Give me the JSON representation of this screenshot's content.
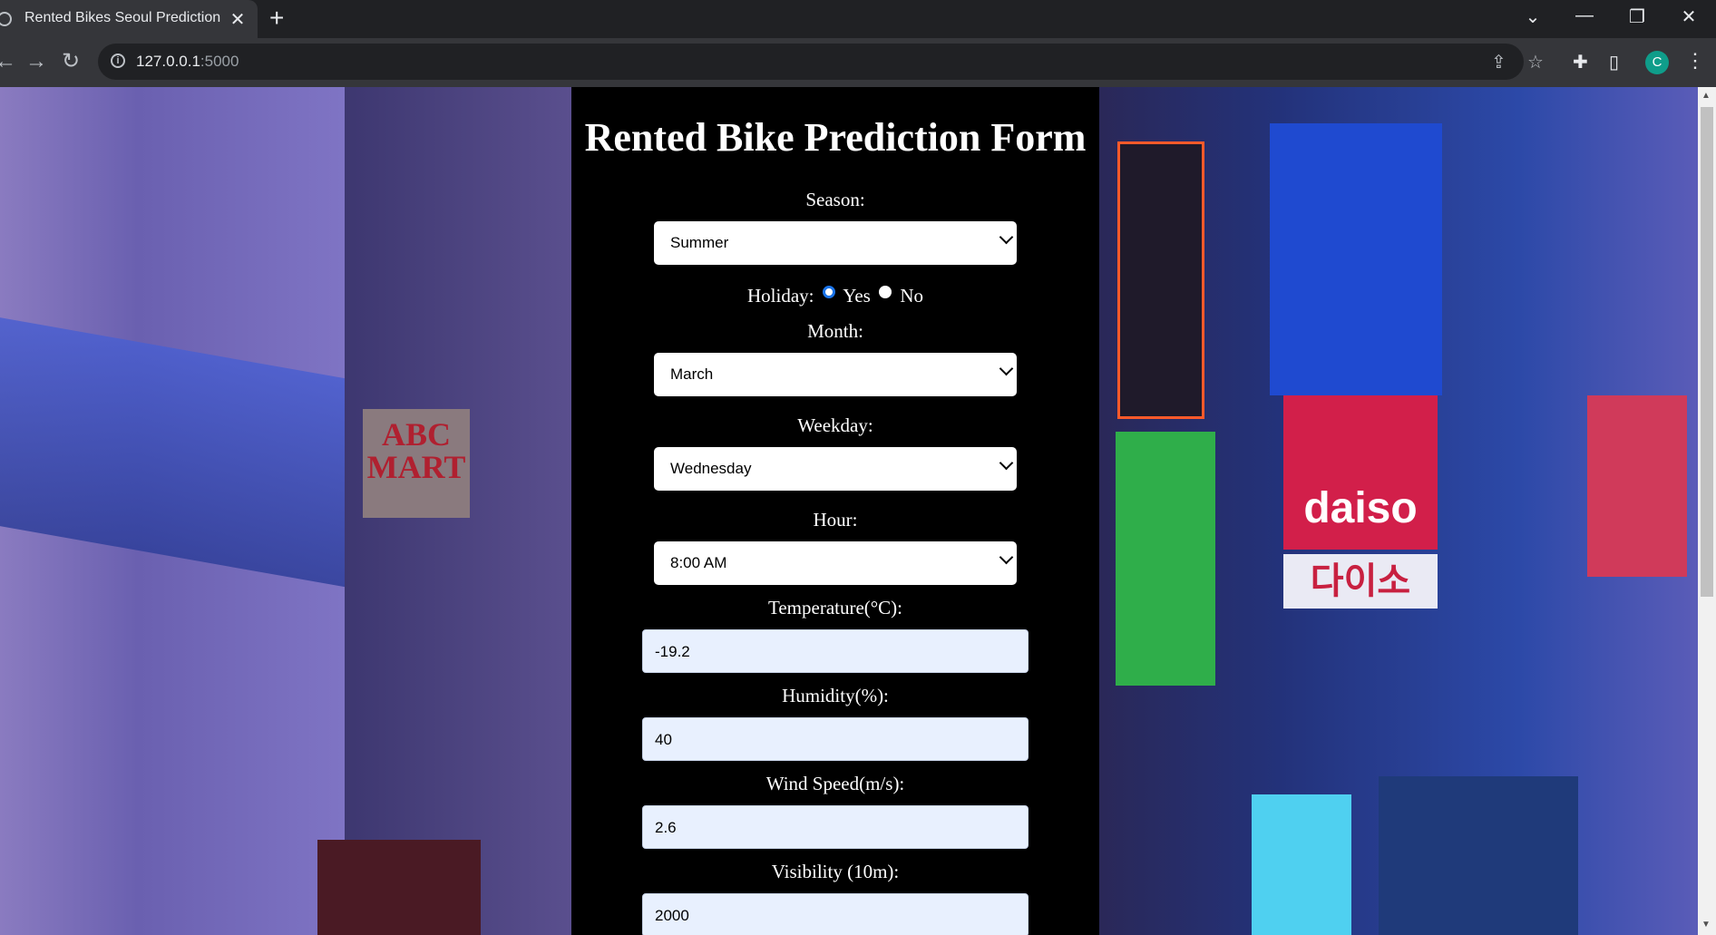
{
  "browser": {
    "tab_title": "Rented Bikes Seoul Prediction",
    "tab_close": "✕",
    "new_tab": "+",
    "url_host": "127.0.0.1",
    "url_port": ":5000",
    "avatar_letter": "C"
  },
  "form": {
    "title": "Rented Bike Prediction Form",
    "season": {
      "label": "Season:",
      "value": "Summer"
    },
    "holiday": {
      "label": "Holiday:",
      "options": [
        "Yes",
        "No"
      ],
      "selected": "Yes"
    },
    "month": {
      "label": "Month:",
      "value": "March"
    },
    "weekday": {
      "label": "Weekday:",
      "value": "Wednesday"
    },
    "hour": {
      "label": "Hour:",
      "value": "8:00 AM"
    },
    "temperature": {
      "label": "Temperature(°C):",
      "value": "-19.2"
    },
    "humidity": {
      "label": "Humidity(%):",
      "value": "40"
    },
    "wind_speed": {
      "label": "Wind Speed(m/s):",
      "value": "2.6"
    },
    "visibility": {
      "label": "Visibility (10m):",
      "value": "2000"
    }
  },
  "background_signs": {
    "abc_mart": "ABC MART",
    "daiso": "daiso",
    "daiso_korean": "다이소"
  },
  "colors": {
    "accent": "#1a73e8",
    "panel": "#000000",
    "input_bg": "#e8f0fe",
    "avatar": "#0f9d8a"
  }
}
